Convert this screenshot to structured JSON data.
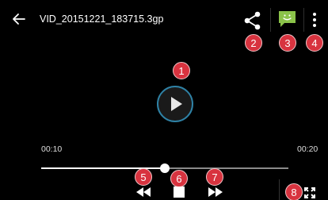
{
  "header": {
    "title": "VID_20151221_183715.3gp",
    "back_icon": "arrow-left-icon",
    "share_icon": "share-icon",
    "message_icon": "message-icon",
    "more_icon": "more-vert-icon",
    "message_icon_color": "#8bc34a"
  },
  "player": {
    "play_icon": "play-icon",
    "elapsed": "00:10",
    "duration": "00:20",
    "progress_fraction": 0.5
  },
  "controls": {
    "rewind_icon": "rewind-icon",
    "stop_icon": "stop-icon",
    "fast_forward_icon": "fast-forward-icon",
    "fullscreen_icon": "fullscreen-icon"
  },
  "callouts": {
    "play": "1",
    "share": "2",
    "message": "3",
    "more": "4",
    "rewind": "5",
    "stop": "6",
    "fast_forward": "7",
    "fullscreen": "8",
    "color": "#d8333f"
  }
}
